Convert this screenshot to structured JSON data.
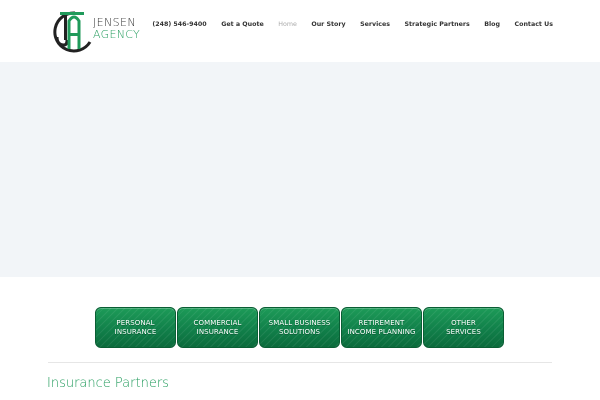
{
  "logo": {
    "line1": "JENSEN",
    "line2": "AGENCY",
    "mark_color": "#1f9a5a",
    "dark_color": "#222222"
  },
  "nav": {
    "items": [
      {
        "label": "(248) 546-9400",
        "active": false
      },
      {
        "label": "Get a Quote",
        "active": false
      },
      {
        "label": "Home",
        "active": true
      },
      {
        "label": "Our Story",
        "active": false
      },
      {
        "label": "Services",
        "active": false
      },
      {
        "label": "Strategic Partners",
        "active": false
      },
      {
        "label": "Blog",
        "active": false
      },
      {
        "label": "Contact Us",
        "active": false
      }
    ]
  },
  "services": {
    "buttons": [
      {
        "label": "PERSONAL\nINSURANCE"
      },
      {
        "label": "COMMERCIAL\nINSURANCE"
      },
      {
        "label": "SMALL BUSINESS\nSOLUTIONS"
      },
      {
        "label": "RETIREMENT\nINCOME PLANNING"
      },
      {
        "label": "OTHER\nSERVICES"
      }
    ],
    "color": "#11804a"
  },
  "section": {
    "title": "Insurance Partners"
  },
  "colors": {
    "accent": "#1f9a5a",
    "hero_bg": "#f2f5f8",
    "nav_text": "#333333",
    "nav_active": "#a9a9a9"
  }
}
